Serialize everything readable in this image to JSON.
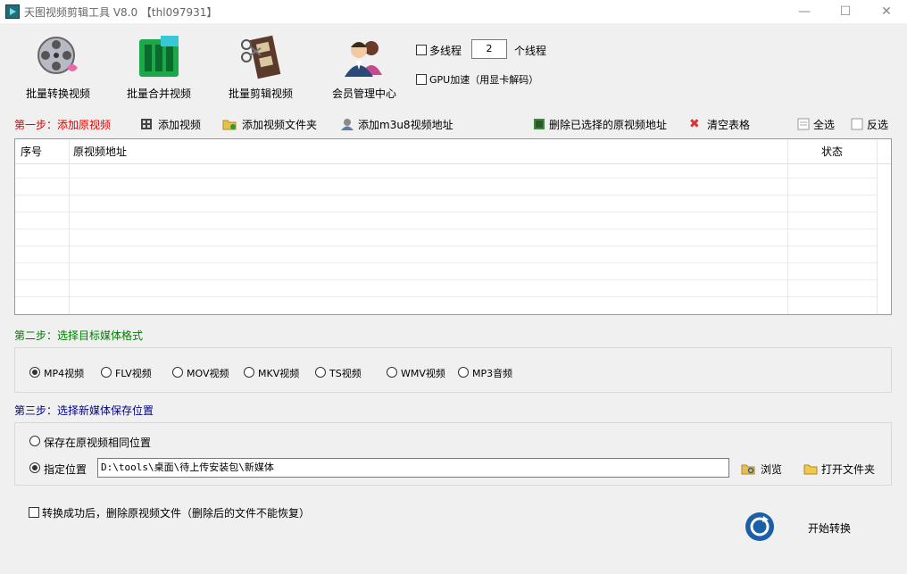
{
  "window": {
    "title": "天图视频剪辑工具 V8.0  【thl097931】",
    "minimize": "—",
    "maximize": "☐",
    "close": "✕"
  },
  "toolbar": {
    "batch_convert": "批量转换视频",
    "batch_merge": "批量合并视频",
    "batch_clip": "批量剪辑视频",
    "member_center": "会员管理中心"
  },
  "options": {
    "multithread_label": "多线程",
    "thread_count": "2",
    "thread_unit": "个线程",
    "gpu_label": "GPU加速（用显卡解码）"
  },
  "step1": {
    "title": "第一步：添加原视频",
    "add_video": "添加视频",
    "add_folder": "添加视频文件夹",
    "add_m3u8": "添加m3u8视频地址",
    "delete_selected": "删除已选择的原视频地址",
    "clear_table": "清空表格",
    "select_all": "全选",
    "invert": "反选",
    "columns": {
      "index": "序号",
      "path": "原视频地址",
      "status": "状态"
    }
  },
  "step2": {
    "title": "第二步：选择目标媒体格式",
    "formats": [
      "MP4视频",
      "FLV视频",
      "MOV视频",
      "MKV视频",
      "TS视频",
      "WMV视频",
      "MP3音频"
    ],
    "selected": "MP4视频"
  },
  "step3": {
    "title": "第三步：选择新媒体保存位置",
    "same_location": "保存在原视频相同位置",
    "specify_location": "指定位置",
    "path": "D:\\tools\\桌面\\待上传安装包\\新媒体",
    "browse": "浏览",
    "open_folder": "打开文件夹"
  },
  "footer": {
    "delete_after": "转换成功后，删除原视频文件（删除后的文件不能恢复）",
    "start": "开始转换"
  },
  "colors": {
    "step1": "#e00000",
    "step2": "#008000",
    "step3": "#00008b"
  }
}
